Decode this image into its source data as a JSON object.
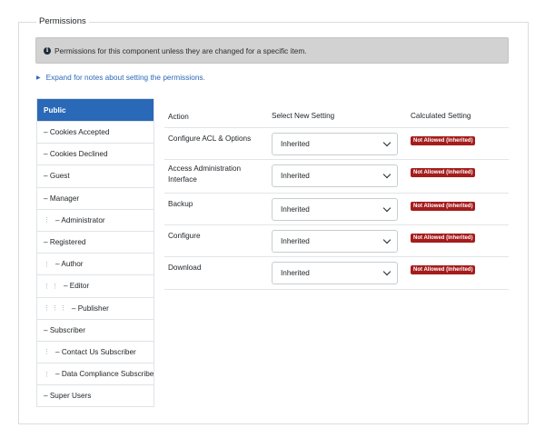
{
  "legend": "Permissions",
  "alert_text": "Permissions for this component unless they are changed for a specific item.",
  "expand_link": "Expand for notes about setting the permissions.",
  "groups": [
    {
      "label": "Public",
      "dots": "",
      "active": true
    },
    {
      "label": "– Cookies Accepted",
      "dots": ""
    },
    {
      "label": "– Cookies Declined",
      "dots": ""
    },
    {
      "label": "– Guest",
      "dots": ""
    },
    {
      "label": "– Manager",
      "dots": ""
    },
    {
      "label": "– Administrator",
      "dots": "⋮"
    },
    {
      "label": "– Registered",
      "dots": ""
    },
    {
      "label": "– Author",
      "dots": "⋮"
    },
    {
      "label": "– Editor",
      "dots": "⋮ ⋮"
    },
    {
      "label": "– Publisher",
      "dots": "⋮ ⋮ ⋮"
    },
    {
      "label": "– Subscriber",
      "dots": ""
    },
    {
      "label": "– Contact Us Subscriber",
      "dots": "⋮"
    },
    {
      "label": "– Data Compliance Subscriber",
      "dots": "⋮"
    },
    {
      "label": "– Super Users",
      "dots": ""
    }
  ],
  "table": {
    "headers": {
      "action": "Action",
      "select": "Select New Setting",
      "calc": "Calculated Setting"
    },
    "rows": [
      {
        "action": "Configure ACL & Options",
        "setting": "Inherited",
        "calculated": "Not Allowed (Inherited)"
      },
      {
        "action": "Access Administration Interface",
        "setting": "Inherited",
        "calculated": "Not Allowed (Inherited)"
      },
      {
        "action": "Backup",
        "setting": "Inherited",
        "calculated": "Not Allowed (Inherited)"
      },
      {
        "action": "Configure",
        "setting": "Inherited",
        "calculated": "Not Allowed (Inherited)"
      },
      {
        "action": "Download",
        "setting": "Inherited",
        "calculated": "Not Allowed (Inherited)"
      }
    ]
  },
  "colors": {
    "accent": "#2a69b8",
    "badge": "#a51c1c",
    "alert_bg": "#d2d2d2"
  }
}
